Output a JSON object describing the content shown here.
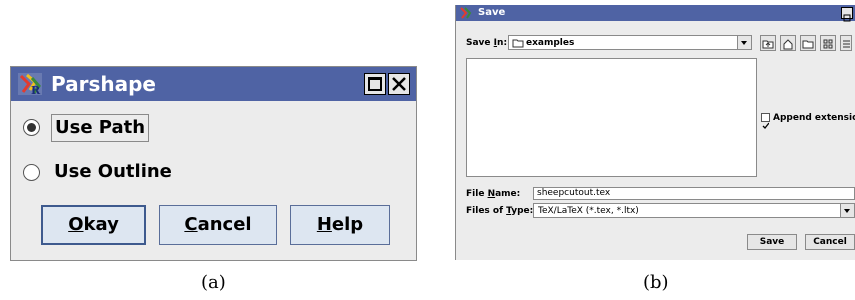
{
  "panel_a": {
    "title": "Parshape",
    "options": [
      {
        "label": "Use Path",
        "selected": true
      },
      {
        "label": "Use Outline",
        "selected": false
      }
    ],
    "buttons": {
      "okay": {
        "mnemonic": "O",
        "rest": "kay"
      },
      "cancel": {
        "mnemonic": "C",
        "rest": "ancel"
      },
      "help": {
        "mnemonic": "H",
        "rest": "elp"
      }
    },
    "caption": "(a)"
  },
  "panel_b": {
    "title": "Save",
    "save_in": {
      "label_pre": "Save ",
      "label_mnemonic": "I",
      "label_post": "n:",
      "value": "examples"
    },
    "append_extension": {
      "label": "Append extension",
      "checked": true
    },
    "file_name": {
      "label_pre": "File ",
      "label_mnemonic": "N",
      "label_post": "ame:",
      "value": "sheepcutout.tex"
    },
    "files_of_type": {
      "label_pre": "Files of ",
      "label_mnemonic": "T",
      "label_post": "ype:",
      "value": "TeX/LaTeX (*.tex, *.ltx)"
    },
    "buttons": {
      "save": "Save",
      "cancel": "Cancel"
    },
    "caption": "(b)"
  },
  "colors": {
    "titlebar": "#4f63a4",
    "button_face": "#dde6f1",
    "dialog_bg": "#ececec"
  }
}
